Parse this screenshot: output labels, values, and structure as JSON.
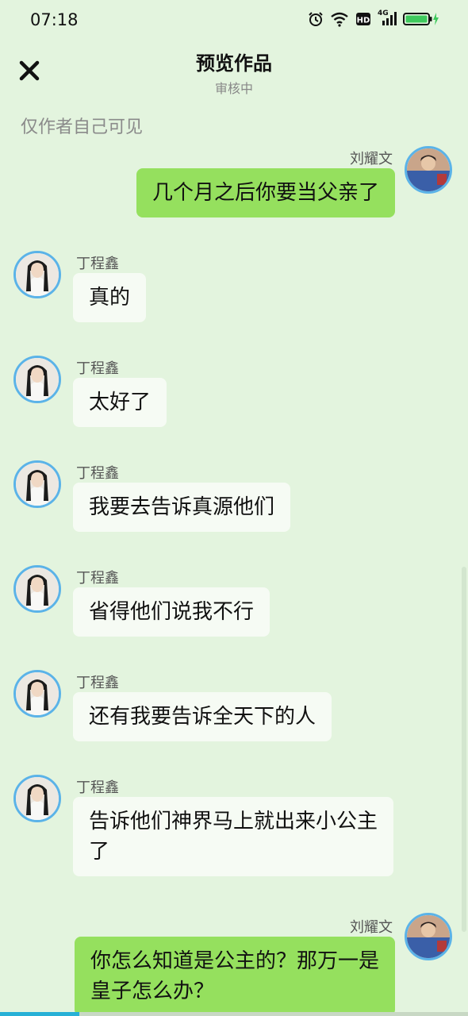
{
  "status": {
    "time": "07:18",
    "network": "4G"
  },
  "header": {
    "title": "预览作品",
    "subtitle": "审核中",
    "visibility": "仅作者自己可见"
  },
  "colors": {
    "background": "#e3f4de",
    "self_bubble": "#95e05e",
    "other_bubble": "#f6fbf4",
    "avatar_ring": "#5bb3e8"
  },
  "messages": [
    {
      "side": "right",
      "sender": "刘耀文",
      "text": "几个月之后你要当父亲了"
    },
    {
      "side": "left",
      "sender": "丁程鑫",
      "text": "真的"
    },
    {
      "side": "left",
      "sender": "丁程鑫",
      "text": "太好了"
    },
    {
      "side": "left",
      "sender": "丁程鑫",
      "text": "我要去告诉真源他们"
    },
    {
      "side": "left",
      "sender": "丁程鑫",
      "text": "省得他们说我不行"
    },
    {
      "side": "left",
      "sender": "丁程鑫",
      "text": "还有我要告诉全天下的人"
    },
    {
      "side": "left",
      "sender": "丁程鑫",
      "text": "告诉他们神界马上就出来小公主了"
    },
    {
      "side": "right",
      "sender": "刘耀文",
      "text": "你怎么知道是公主的？那万一是皇子怎么办？"
    }
  ],
  "progress": 0.17
}
